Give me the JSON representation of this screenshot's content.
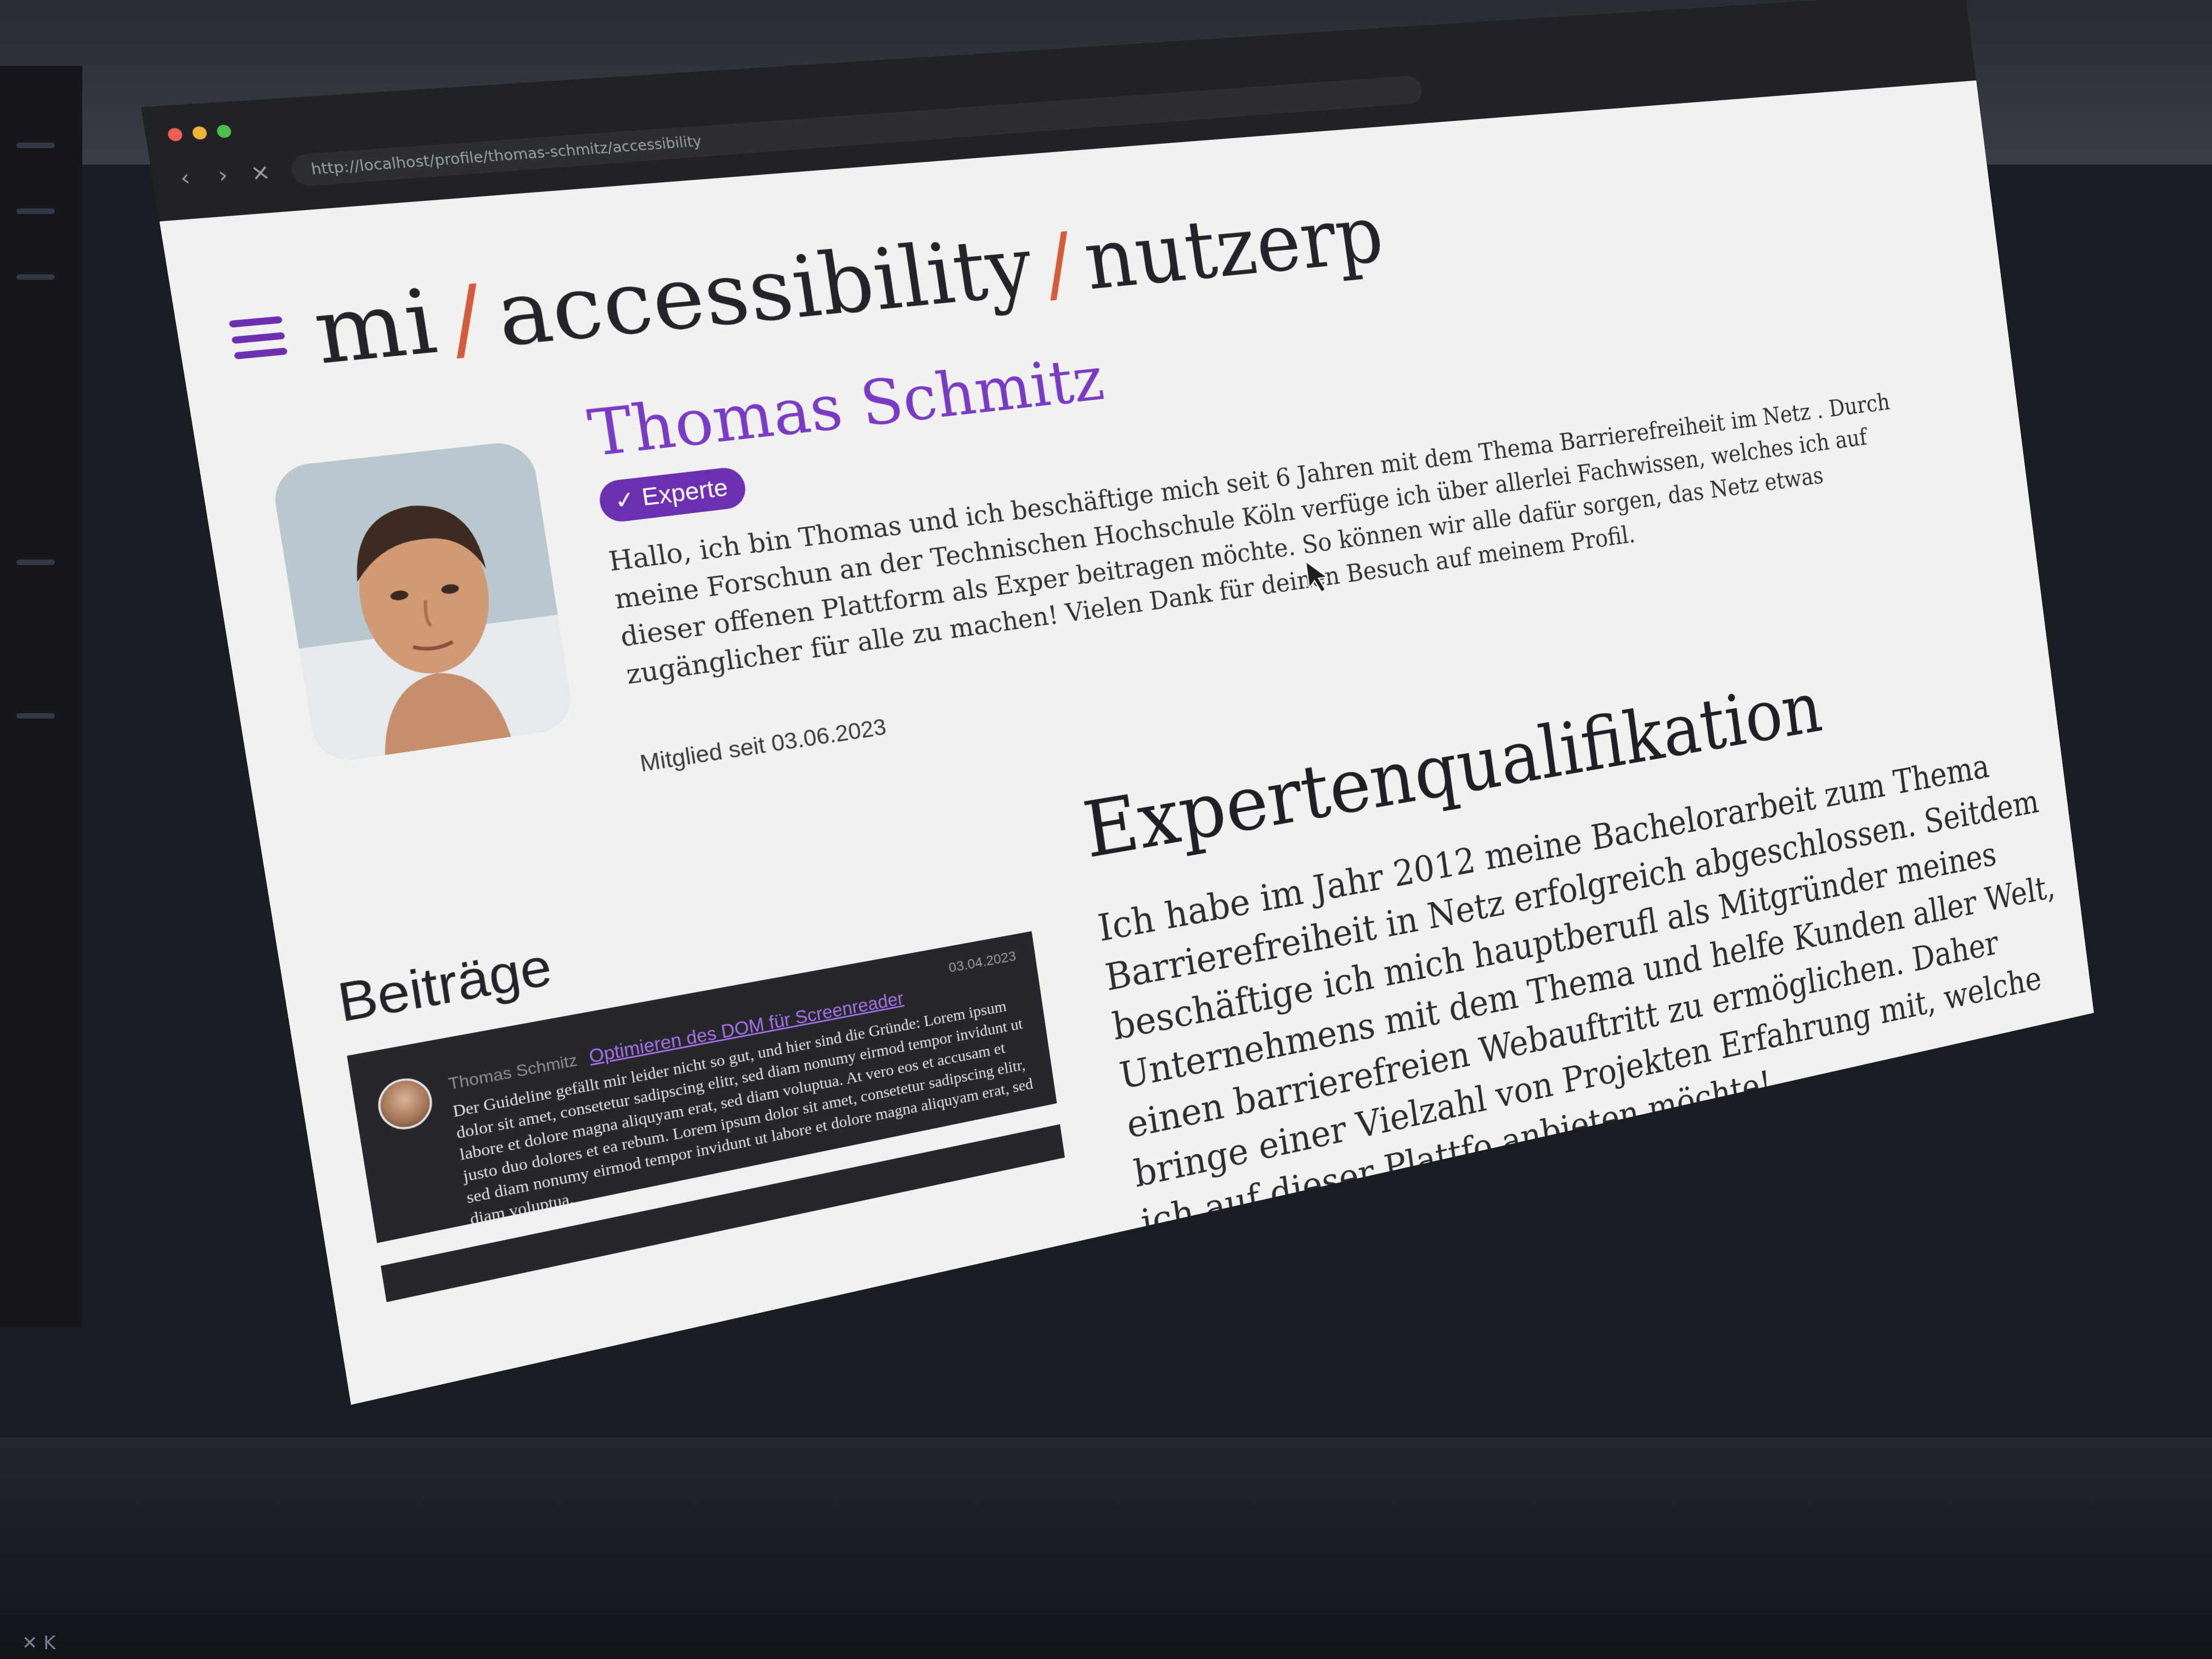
{
  "browser": {
    "url": "http://localhost/profile/thomas-schmitz/accessibility",
    "back_icon": "arrow-left-icon",
    "forward_icon": "arrow-right-icon",
    "close_icon": "close-icon"
  },
  "site": {
    "brand_part1": "mi",
    "brand_sep": "/",
    "brand_part2": "accessibility",
    "brand_part3": "nutzerp",
    "menu_icon": "hamburger-menu-icon"
  },
  "profile": {
    "name": "Thomas Schmitz",
    "badge_check": "✓",
    "badge_label": "Experte",
    "bio": "Hallo, ich bin Thomas und ich beschäftige mich seit 6 Jahren mit dem Thema Barrierefreiheit im Netz . Durch meine Forschun an der Technischen Hochschule Köln verfüge ich über allerlei Fachwissen, welches ich auf dieser offenen Plattform als Exper beitragen möchte. So können wir alle dafür sorgen, das Netz etwas zugänglicher für alle zu machen! Vielen Dank für deinen Besuch auf meinem Profil.",
    "member_since": "Mitglied seit 03.06.2023"
  },
  "posts": {
    "title": "Beiträge",
    "items": [
      {
        "author": "Thomas Schmitz",
        "date": "03.04.2023",
        "link": "Optimieren des DOM für Screenreader",
        "excerpt": "Der Guideline gefällt mir leider nicht so gut, und hier sind die Gründe: Lorem ipsum dolor sit amet, consetetur sadipscing elitr, sed diam nonumy eirmod tempor invidunt ut labore et dolore magna aliquyam erat, sed diam voluptua. At vero eos et accusam et justo duo dolores et ea rebum. Lorem ipsum dolor sit amet, consetetur sadipscing elitr, sed diam nonumy eirmod tempor invidunt ut labore et dolore magna aliquyam erat, sed diam voluptua."
      }
    ]
  },
  "qualification": {
    "title": "Expertenqualifikation",
    "text": "Ich habe im Jahr 2012 meine Bachelorarbeit zum Thema Barrierefreiheit in Netz erfolgreich abgeschlossen. Seitdem beschäftige ich mich hauptberufl als Mitgründer meines Unternehmens mit dem Thema und helfe Kunden aller Welt, einen barrierefreien Webauftritt zu ermöglichen. Daher bringe einer Vielzahl von Projekten Erfahrung mit, welche ich auf dieser Plattfo anbieten möchte!"
  },
  "taskbar": {
    "label": "✕ K"
  },
  "colors": {
    "accent": "#6b2fb0",
    "name": "#7a3bc4",
    "separator": "#d35a3b",
    "card": "#26272c"
  }
}
